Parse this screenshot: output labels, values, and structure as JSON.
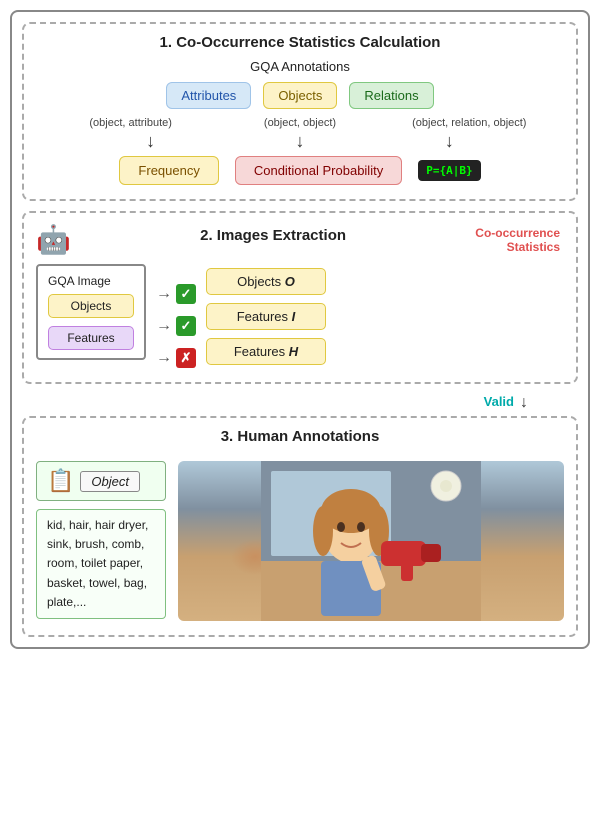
{
  "section1": {
    "title": "1. Co-Occurrence Statistics Calculation",
    "gqa_label": "GQA Annotations",
    "boxes": {
      "attributes": "Attributes",
      "objects": "Objects",
      "relations": "Relations"
    },
    "arrow_labels": {
      "left": "(object, attribute)",
      "center": "(object, object)",
      "right": "(object, relation, object)"
    },
    "frequency": "Frequency",
    "conditional_probability": "Conditional Probability",
    "formula": "P={A|B}"
  },
  "section2": {
    "title": "2. Images Extraction",
    "cooccurrence_label": "Co-occurrence",
    "statistics_label": "Statistics",
    "gqa_image_label": "GQA Image",
    "objects_label": "Objects",
    "features_label": "Features",
    "right_items": [
      {
        "label": "Objects ",
        "italic": "O"
      },
      {
        "label": "Features ",
        "italic": "I"
      },
      {
        "label": "Features ",
        "italic": "H"
      }
    ],
    "check1": "✓",
    "check2": "✓",
    "cross": "✗"
  },
  "section3": {
    "title": "3. Human Annotations",
    "valid_label": "Valid",
    "object_label": "Object",
    "keywords": "kid, hair, hair dryer,\nsink, brush, comb,\nroom, toilet paper,\nbasket, towel, bag,\nplate,..."
  }
}
